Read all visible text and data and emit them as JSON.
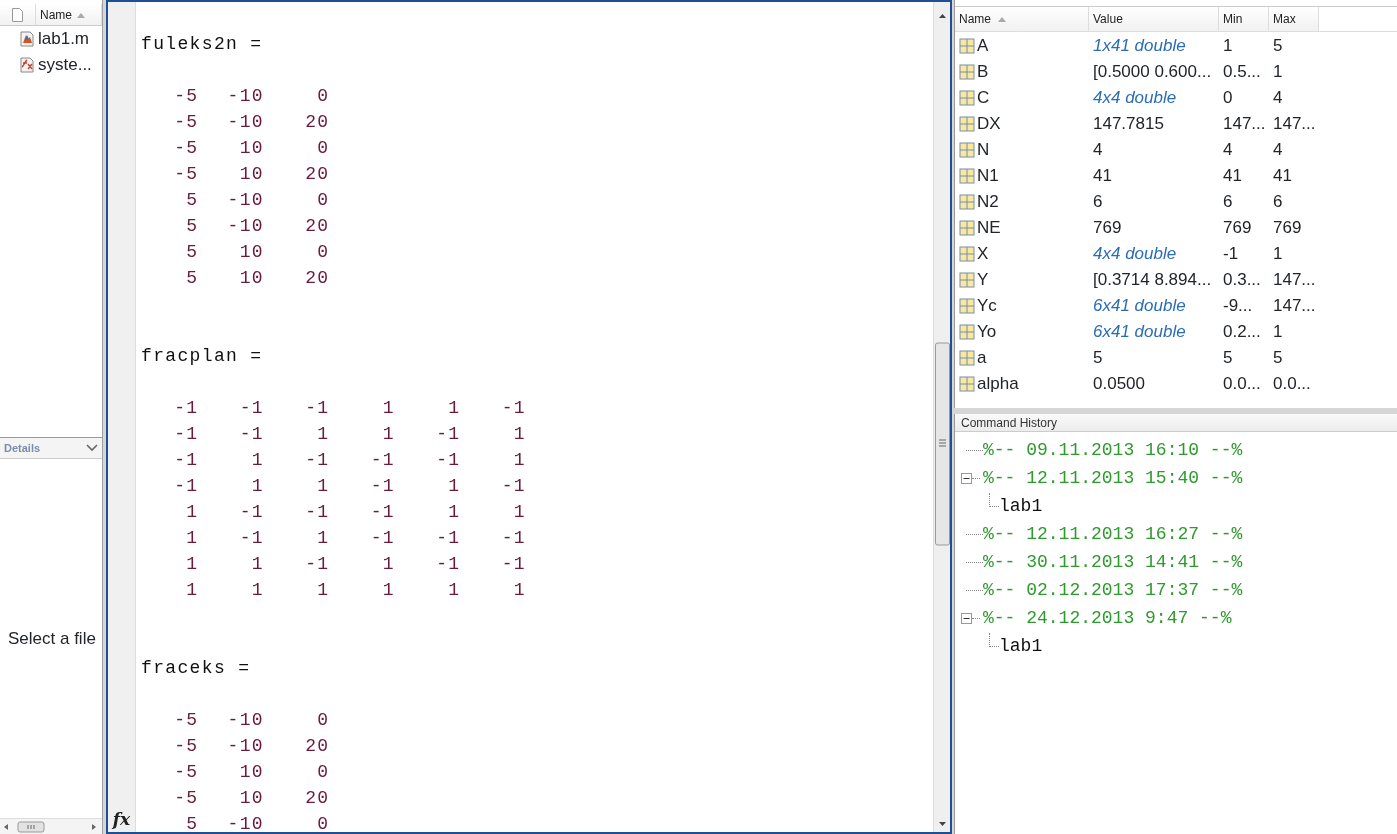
{
  "file_browser": {
    "columns": [
      "Name"
    ],
    "sort_ascending": true,
    "files": [
      {
        "name": "lab1.m",
        "kind": "script"
      },
      {
        "name": "syste...",
        "kind": "function"
      }
    ],
    "details": {
      "title": "Details",
      "message": "Select a file"
    }
  },
  "command_window": {
    "blocks": [
      {
        "name": "fuleks2n =",
        "rows": [
          [
            "-5",
            "-10",
            "0"
          ],
          [
            "-5",
            "-10",
            "20"
          ],
          [
            "-5",
            "10",
            "0"
          ],
          [
            "-5",
            "10",
            "20"
          ],
          [
            "5",
            "-10",
            "0"
          ],
          [
            "5",
            "-10",
            "20"
          ],
          [
            "5",
            "10",
            "0"
          ],
          [
            "5",
            "10",
            "20"
          ]
        ]
      },
      {
        "name": "fracplan =",
        "rows": [
          [
            "-1",
            "-1",
            "-1",
            "1",
            "1",
            "-1"
          ],
          [
            "-1",
            "-1",
            "1",
            "1",
            "-1",
            "1"
          ],
          [
            "-1",
            "1",
            "-1",
            "-1",
            "-1",
            "1"
          ],
          [
            "-1",
            "1",
            "1",
            "-1",
            "1",
            "-1"
          ],
          [
            "1",
            "-1",
            "-1",
            "-1",
            "1",
            "1"
          ],
          [
            "1",
            "-1",
            "1",
            "-1",
            "-1",
            "-1"
          ],
          [
            "1",
            "1",
            "-1",
            "1",
            "-1",
            "-1"
          ],
          [
            "1",
            "1",
            "1",
            "1",
            "1",
            "1"
          ]
        ]
      },
      {
        "name": "fraceks =",
        "rows": [
          [
            "-5",
            "-10",
            "0"
          ],
          [
            "-5",
            "-10",
            "20"
          ],
          [
            "-5",
            "10",
            "0"
          ],
          [
            "-5",
            "10",
            "20"
          ],
          [
            "5",
            "-10",
            "0"
          ]
        ]
      }
    ],
    "prompt_icon": "fx"
  },
  "workspace": {
    "columns": [
      "Name",
      "Value",
      "Min",
      "Max"
    ],
    "rows": [
      {
        "name": "A",
        "value": "1x41 double",
        "summary": true,
        "min": "1",
        "max": "5"
      },
      {
        "name": "B",
        "value": "[0.5000 0.600...",
        "summary": false,
        "min": "0.5...",
        "max": "1"
      },
      {
        "name": "C",
        "value": "4x4 double",
        "summary": true,
        "min": "0",
        "max": "4"
      },
      {
        "name": "DX",
        "value": "147.7815",
        "summary": false,
        "min": "147...",
        "max": "147..."
      },
      {
        "name": "N",
        "value": "4",
        "summary": false,
        "min": "4",
        "max": "4"
      },
      {
        "name": "N1",
        "value": "41",
        "summary": false,
        "min": "41",
        "max": "41"
      },
      {
        "name": "N2",
        "value": "6",
        "summary": false,
        "min": "6",
        "max": "6"
      },
      {
        "name": "NE",
        "value": "769",
        "summary": false,
        "min": "769",
        "max": "769"
      },
      {
        "name": "X",
        "value": "4x4 double",
        "summary": true,
        "min": "-1",
        "max": "1"
      },
      {
        "name": "Y",
        "value": "[0.3714 8.894...",
        "summary": false,
        "min": "0.3...",
        "max": "147..."
      },
      {
        "name": "Yc",
        "value": "6x41 double",
        "summary": true,
        "min": "-9...",
        "max": "147..."
      },
      {
        "name": "Yo",
        "value": "6x41 double",
        "summary": true,
        "min": "0.2...",
        "max": "1"
      },
      {
        "name": "a",
        "value": "5",
        "summary": false,
        "min": "5",
        "max": "5"
      },
      {
        "name": "alpha",
        "value": "0.0500",
        "summary": false,
        "min": "0.0...",
        "max": "0.0..."
      }
    ]
  },
  "command_history": {
    "title": "Command History",
    "sessions": [
      {
        "label": "%-- 09.11.2013 16:10 --%",
        "expanded": false
      },
      {
        "label": "%-- 12.11.2013 15:40 --%",
        "expanded": true,
        "children": [
          {
            "label": "lab1"
          }
        ]
      },
      {
        "label": "%-- 12.11.2013 16:27 --%",
        "expanded": false
      },
      {
        "label": "%-- 30.11.2013 14:41 --%",
        "expanded": false
      },
      {
        "label": "%-- 02.12.2013 17:37 --%",
        "expanded": false
      },
      {
        "label": "%-- 24.12.2013 9:47 --%",
        "expanded": true,
        "children": [
          {
            "label": "lab1"
          }
        ]
      }
    ]
  }
}
